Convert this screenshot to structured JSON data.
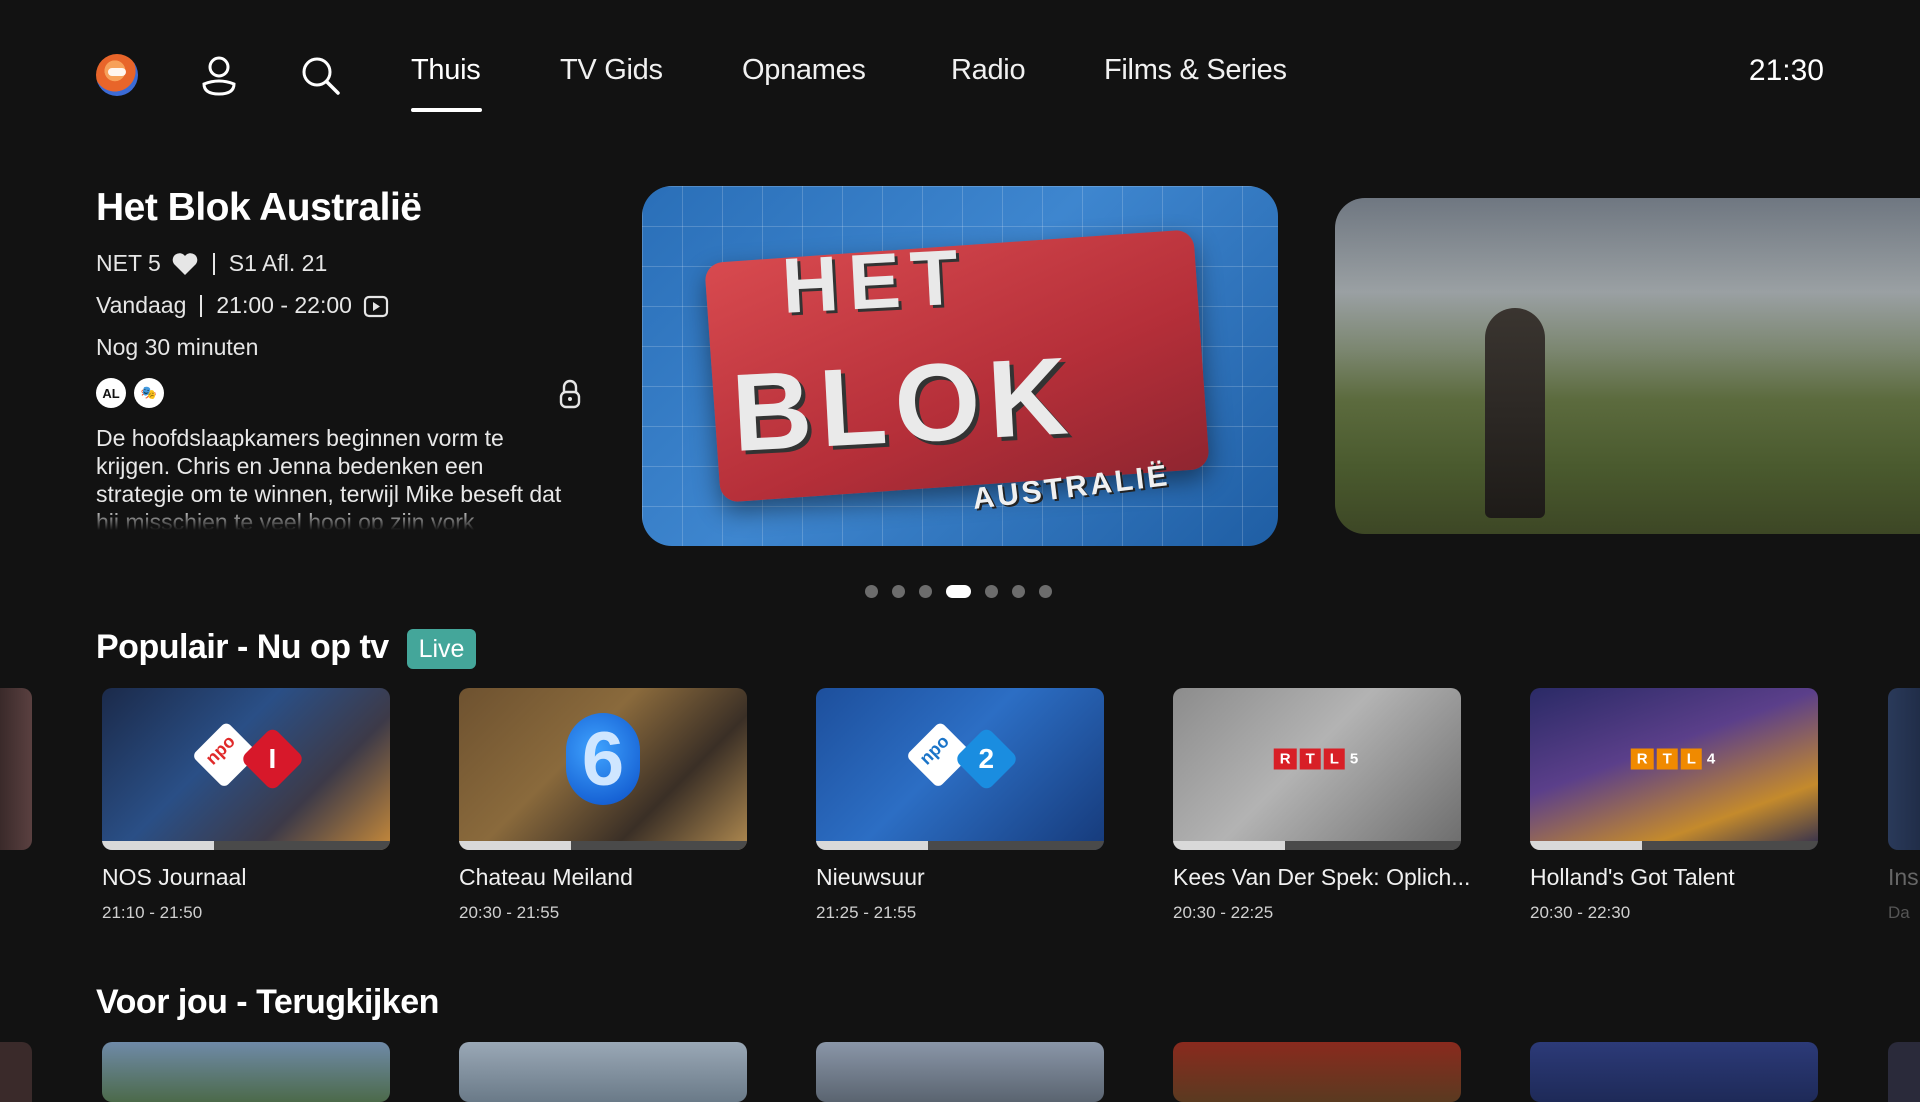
{
  "nav": {
    "tabs": [
      "Thuis",
      "TV Gids",
      "Opnames",
      "Radio",
      "Films & Series"
    ],
    "active_tab": "Thuis",
    "clock": "21:30"
  },
  "hero": {
    "title": "Het Blok Australië",
    "channel": "NET 5",
    "episode": "S1 Afl. 21",
    "day": "Vandaag",
    "time": "21:00 - 22:00",
    "remaining": "Nog 30 minuten",
    "rating_badges": [
      "AL",
      "🎭"
    ],
    "description": "De hoofdslaapkamers beginnen vorm te krijgen. Chris en Jenna bedenken een strategie om te winnen, terwijl Mike beseft dat hij misschien te veel hooi op zijn vork",
    "image_text": {
      "line1": "HET",
      "line2": "BLOK",
      "line3": "AUSTRALIË"
    },
    "carousel": {
      "count": 7,
      "active_index": 3
    }
  },
  "sections": {
    "popular_title": "Populair - Nu op tv",
    "live_label": "Live",
    "foryou_title": "Voor jou - Terugkijken"
  },
  "popular": [
    {
      "title": "NOS Journaal",
      "time": "21:10 - 21:50",
      "progress": 0.39,
      "channel_logo": "NPO 1",
      "color": "#c9273a"
    },
    {
      "title": "Chateau Meiland",
      "time": "20:30 - 21:55",
      "progress": 0.39,
      "channel_logo": "6",
      "color": "#1f6fd6"
    },
    {
      "title": "Nieuwsuur",
      "time": "21:25 - 21:55",
      "progress": 0.39,
      "channel_logo": "NPO 2",
      "color": "#1a74c8"
    },
    {
      "title": "Kees Van Der Spek: Oplich...",
      "time": "20:30 - 22:25",
      "progress": 0.39,
      "channel_logo": "RTL 5",
      "color": "#d81f26"
    },
    {
      "title": "Holland's Got Talent",
      "time": "20:30 - 22:30",
      "progress": 0.39,
      "channel_logo": "RTL 4",
      "color": "#f08a00"
    }
  ],
  "partial_card": {
    "title": "Ins",
    "time": "Da"
  },
  "colors": {
    "background": "#121212",
    "live_badge": "#44a69a"
  }
}
